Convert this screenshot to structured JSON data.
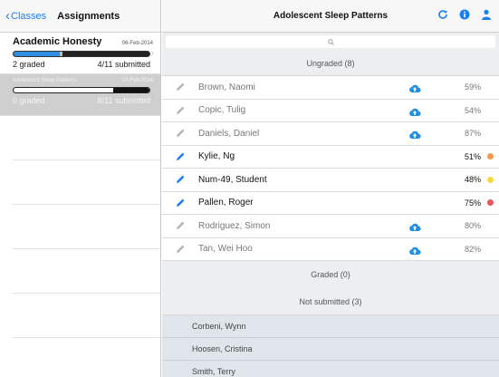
{
  "left_nav": {
    "back_label": "Classes",
    "title": "Assignments"
  },
  "assignments": [
    {
      "name": "Academic Honesty",
      "date": "06-Feb-2014",
      "graded": "2 graded",
      "submitted": "4/11 submitted",
      "progress_graded": 0.34,
      "progress_submitted": 0.36,
      "selected": false
    },
    {
      "name": "Adolescent Sleep Patterns",
      "date": "24-Feb-2014",
      "graded": "0 graded",
      "submitted": "8/11 submitted",
      "progress_graded": 0.0,
      "progress_submitted": 0.73,
      "selected": true
    }
  ],
  "right_nav": {
    "title": "Adolescent Sleep Patterns",
    "icons": [
      "refresh-icon",
      "info-icon",
      "person-icon"
    ],
    "accent": "#1a7ef5"
  },
  "search": {
    "placeholder": ""
  },
  "sections": {
    "ungraded": "Ungraded (8)",
    "graded": "Graded (0)",
    "not_submitted": "Not submitted (3)"
  },
  "ungraded_students": [
    {
      "name": "Brown, Naomi",
      "percent": "59%",
      "cloud": true,
      "active": false,
      "dot": null
    },
    {
      "name": "Copic, Tulig",
      "percent": "54%",
      "cloud": true,
      "active": false,
      "dot": null
    },
    {
      "name": "Daniels, Daniel",
      "percent": "87%",
      "cloud": true,
      "active": false,
      "dot": null
    },
    {
      "name": "Kylie, Ng",
      "percent": "51%",
      "cloud": false,
      "active": true,
      "dot": "#f39a4e"
    },
    {
      "name": "Num-49, Student",
      "percent": "48%",
      "cloud": false,
      "active": true,
      "dot": "#f7d93c"
    },
    {
      "name": "Pallen, Roger",
      "percent": "75%",
      "cloud": false,
      "active": true,
      "dot": "#e8545a"
    },
    {
      "name": "Rodriguez, Simon",
      "percent": "80%",
      "cloud": true,
      "active": false,
      "dot": null
    },
    {
      "name": "Tan, Wei Hoo",
      "percent": "82%",
      "cloud": true,
      "active": false,
      "dot": null
    }
  ],
  "not_submitted_students": [
    "Corbeni, Wynn",
    "Hoosen, Cristina",
    "Smith, Terry"
  ]
}
